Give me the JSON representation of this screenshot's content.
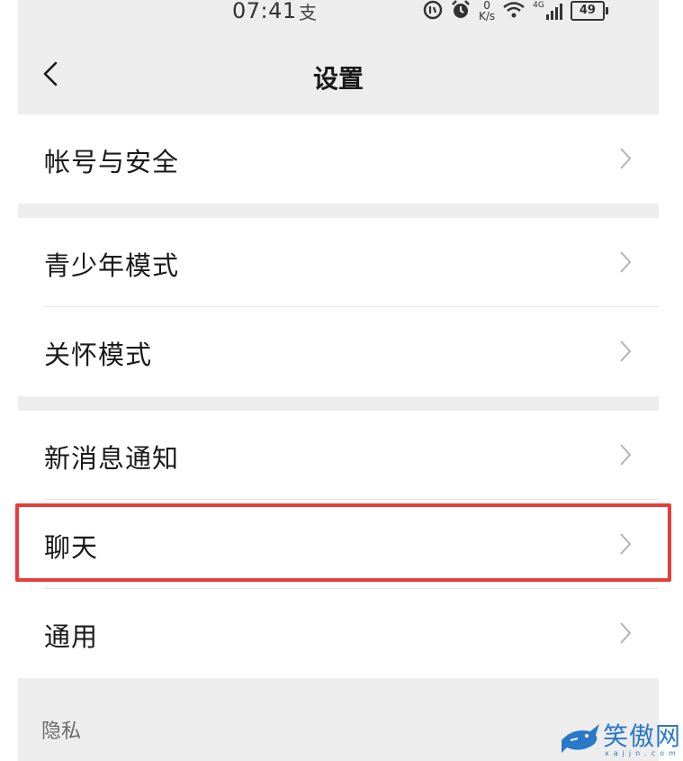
{
  "status_bar": {
    "time": "07:41",
    "time_extra": "支",
    "speed_value": "0",
    "speed_unit": "K/s",
    "network": "4G",
    "battery": "49"
  },
  "nav": {
    "title": "设置"
  },
  "groups": [
    {
      "items": [
        {
          "label": "帐号与安全"
        }
      ]
    },
    {
      "items": [
        {
          "label": "青少年模式"
        },
        {
          "label": "关怀模式"
        }
      ]
    },
    {
      "items": [
        {
          "label": "新消息通知"
        },
        {
          "label": "聊天"
        },
        {
          "label": "通用"
        }
      ]
    }
  ],
  "privacy_section": {
    "label": "隐私"
  },
  "highlighted_item": "聊天",
  "watermark": {
    "text": "笑傲网",
    "sub": "xajjn.com"
  },
  "colors": {
    "background": "#ededed",
    "card": "#ffffff",
    "highlight_border": "#ea3b3b",
    "watermark": "#2a78c8"
  }
}
